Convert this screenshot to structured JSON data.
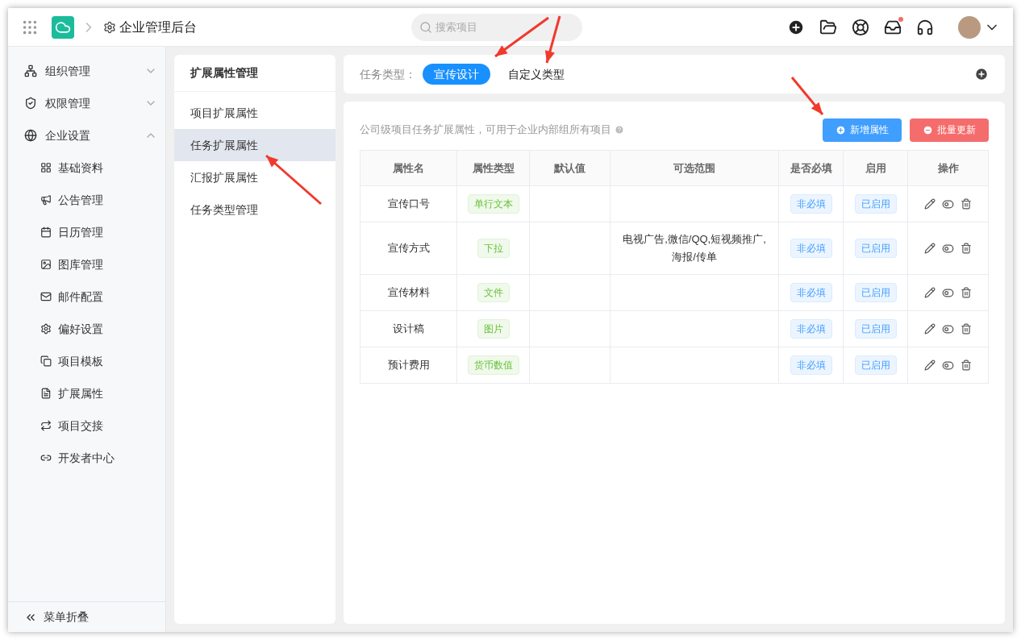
{
  "header": {
    "title": "企业管理后台",
    "search": {
      "placeholder": "搜索项目"
    },
    "inbox_unread": true
  },
  "sidebar": {
    "groups": [
      {
        "label": "组织管理",
        "expanded": false
      },
      {
        "label": "权限管理",
        "expanded": false
      },
      {
        "label": "企业设置",
        "expanded": true,
        "children": [
          "基础资料",
          "公告管理",
          "日历管理",
          "图库管理",
          "邮件配置",
          "偏好设置",
          "项目模板",
          "扩展属性",
          "项目交接",
          "开发者中心"
        ]
      }
    ],
    "collapse_label": "菜单折叠"
  },
  "submenu": {
    "title": "扩展属性管理",
    "items": [
      {
        "label": "项目扩展属性",
        "selected": false
      },
      {
        "label": "任务扩展属性",
        "selected": true
      },
      {
        "label": "汇报扩展属性",
        "selected": false
      },
      {
        "label": "任务类型管理",
        "selected": false
      }
    ]
  },
  "task_types": {
    "label": "任务类型：",
    "items": [
      {
        "label": "宣传设计",
        "selected": true
      },
      {
        "label": "自定义类型",
        "selected": false
      }
    ]
  },
  "content": {
    "description": "公司级项目任务扩展属性，可用于企业内部组所有项目",
    "buttons": [
      {
        "label": "新增属性",
        "kind": "primary"
      },
      {
        "label": "批量更新",
        "kind": "danger"
      }
    ]
  },
  "table": {
    "columns": [
      "属性名",
      "属性类型",
      "默认值",
      "可选范围",
      "是否必填",
      "启用",
      "操作"
    ],
    "rows": [
      {
        "name": "宣传口号",
        "type": "单行文本",
        "default": "",
        "range": "",
        "required": "非必填",
        "enabled": "已启用"
      },
      {
        "name": "宣传方式",
        "type": "下拉",
        "default": "",
        "range": "电视广告,微信/QQ,短视频推广,海报/传单",
        "required": "非必填",
        "enabled": "已启用"
      },
      {
        "name": "宣传材料",
        "type": "文件",
        "default": "",
        "range": "",
        "required": "非必填",
        "enabled": "已启用"
      },
      {
        "name": "设计稿",
        "type": "图片",
        "default": "",
        "range": "",
        "required": "非必填",
        "enabled": "已启用"
      },
      {
        "name": "预计费用",
        "type": "货币数值",
        "default": "",
        "range": "",
        "required": "非必填",
        "enabled": "已启用"
      }
    ]
  }
}
